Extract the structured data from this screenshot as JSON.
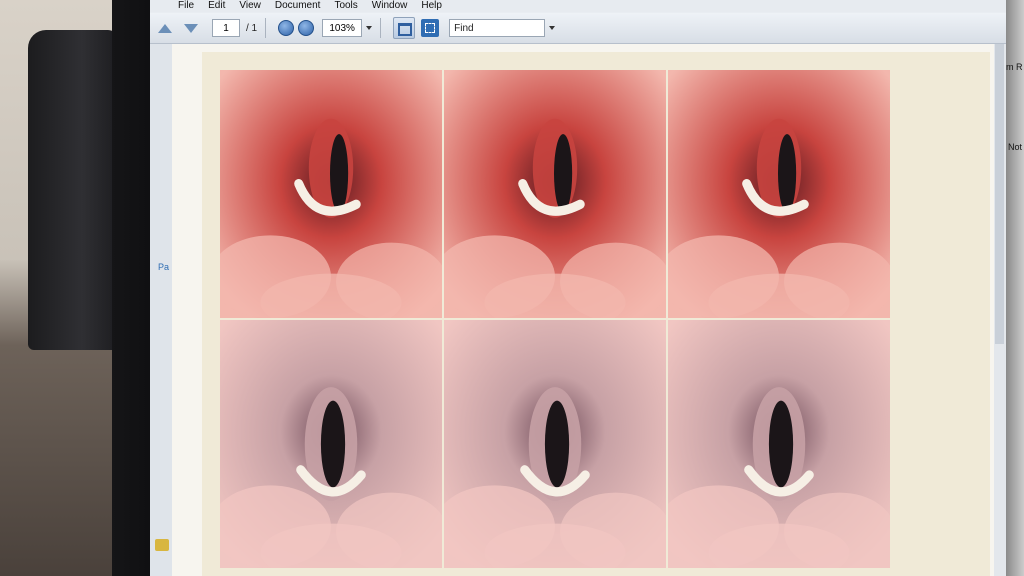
{
  "menu": {
    "items": [
      "File",
      "Edit",
      "View",
      "Document",
      "Tools",
      "Window",
      "Help"
    ]
  },
  "toolbar": {
    "page_current": "1",
    "page_total": "/ 1",
    "zoom": "103%",
    "find_label": "Find"
  },
  "side_panel": {
    "top_right": "m R",
    "mid_right": "Not",
    "left_edge": "Pa"
  },
  "images": [
    {
      "name": "laryngoscopy-frame-1",
      "tone": "red"
    },
    {
      "name": "laryngoscopy-frame-2",
      "tone": "red"
    },
    {
      "name": "laryngoscopy-frame-3",
      "tone": "red"
    },
    {
      "name": "laryngoscopy-frame-4",
      "tone": "pale"
    },
    {
      "name": "laryngoscopy-frame-5",
      "tone": "pale"
    },
    {
      "name": "laryngoscopy-frame-6",
      "tone": "pale"
    }
  ],
  "colors": {
    "tissue_red": "#c8443f",
    "tissue_dark": "#5a1a20",
    "tissue_pale": "#c7a1a5",
    "tissue_light": "#f1c6c2",
    "epiglottis": "#f6efe5",
    "glottis": "#1b1518"
  }
}
